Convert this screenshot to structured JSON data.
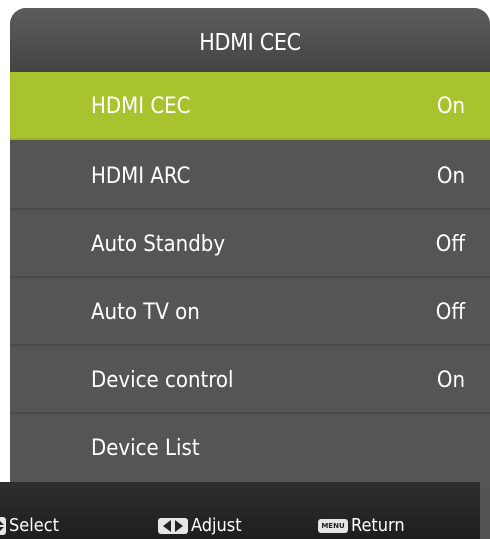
{
  "menu": {
    "title": "HDMI CEC",
    "items": [
      {
        "label": "HDMI CEC",
        "value": "On"
      },
      {
        "label": "HDMI ARC",
        "value": "On"
      },
      {
        "label": "Auto Standby",
        "value": "Off"
      },
      {
        "label": "Auto TV on",
        "value": "Off"
      },
      {
        "label": "Device control",
        "value": "On"
      },
      {
        "label": "Device List",
        "value": ""
      }
    ],
    "highlight_index": 0
  },
  "footer": {
    "select_label": "Select",
    "adjust_label": "Adjust",
    "return_label": "Return",
    "menu_key_text": "MENU",
    "select_icon": "up-down-arrow-icon",
    "adjust_icon": "left-right-arrow-icon",
    "return_icon": "menu-key-icon"
  },
  "colors": {
    "highlight": "#a7c42e",
    "row_background": "#555555",
    "footer_background": "#262626",
    "text": "#ffffff"
  }
}
